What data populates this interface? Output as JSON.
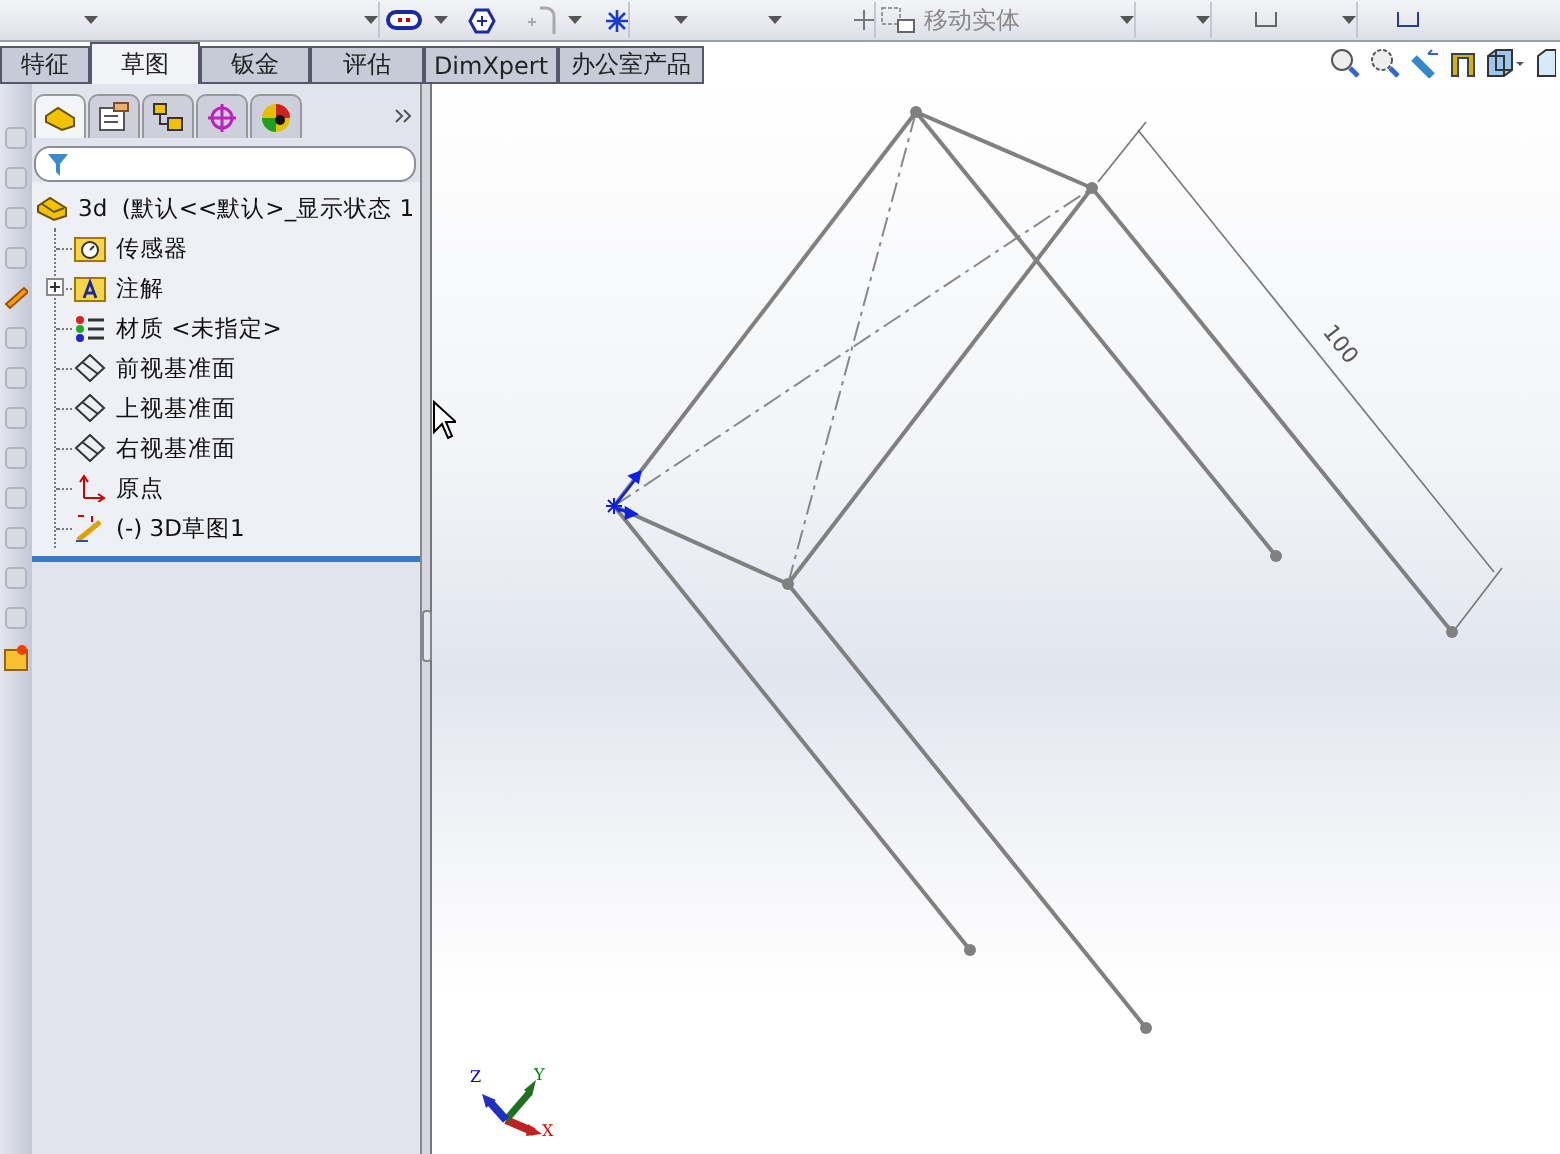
{
  "toolbar": {
    "move_entities_label": "移动实体"
  },
  "tabs": [
    {
      "label": "特征",
      "selected": false
    },
    {
      "label": "草图",
      "selected": true
    },
    {
      "label": "钣金",
      "selected": false
    },
    {
      "label": "评估",
      "selected": false
    },
    {
      "label": "DimXpert",
      "selected": false
    },
    {
      "label": "办公室产品",
      "selected": false
    }
  ],
  "panel_tabs": [
    {
      "kind": "feature-tree",
      "selected": true
    },
    {
      "kind": "properties",
      "selected": false
    },
    {
      "kind": "configurations",
      "selected": false
    },
    {
      "kind": "dimxpert",
      "selected": false
    },
    {
      "kind": "appearance",
      "selected": false
    }
  ],
  "tree": {
    "label": "3d  (默认<<默认>_显示状态 1",
    "kind": "part",
    "children": [
      {
        "label": "传感器",
        "kind": "sensor"
      },
      {
        "label": "注解",
        "kind": "annotation",
        "expanded": false
      },
      {
        "label": "材质 <未指定>",
        "kind": "material"
      },
      {
        "label": "前视基准面",
        "kind": "plane"
      },
      {
        "label": "上视基准面",
        "kind": "plane"
      },
      {
        "label": "右视基准面",
        "kind": "plane"
      },
      {
        "label": "原点",
        "kind": "origin"
      },
      {
        "label": "(-) 3D草图1",
        "kind": "sketch"
      }
    ]
  },
  "viewport": {
    "dimension": "100",
    "axes": [
      {
        "label": "X"
      },
      {
        "label": "Y"
      },
      {
        "label": "Z"
      }
    ]
  }
}
